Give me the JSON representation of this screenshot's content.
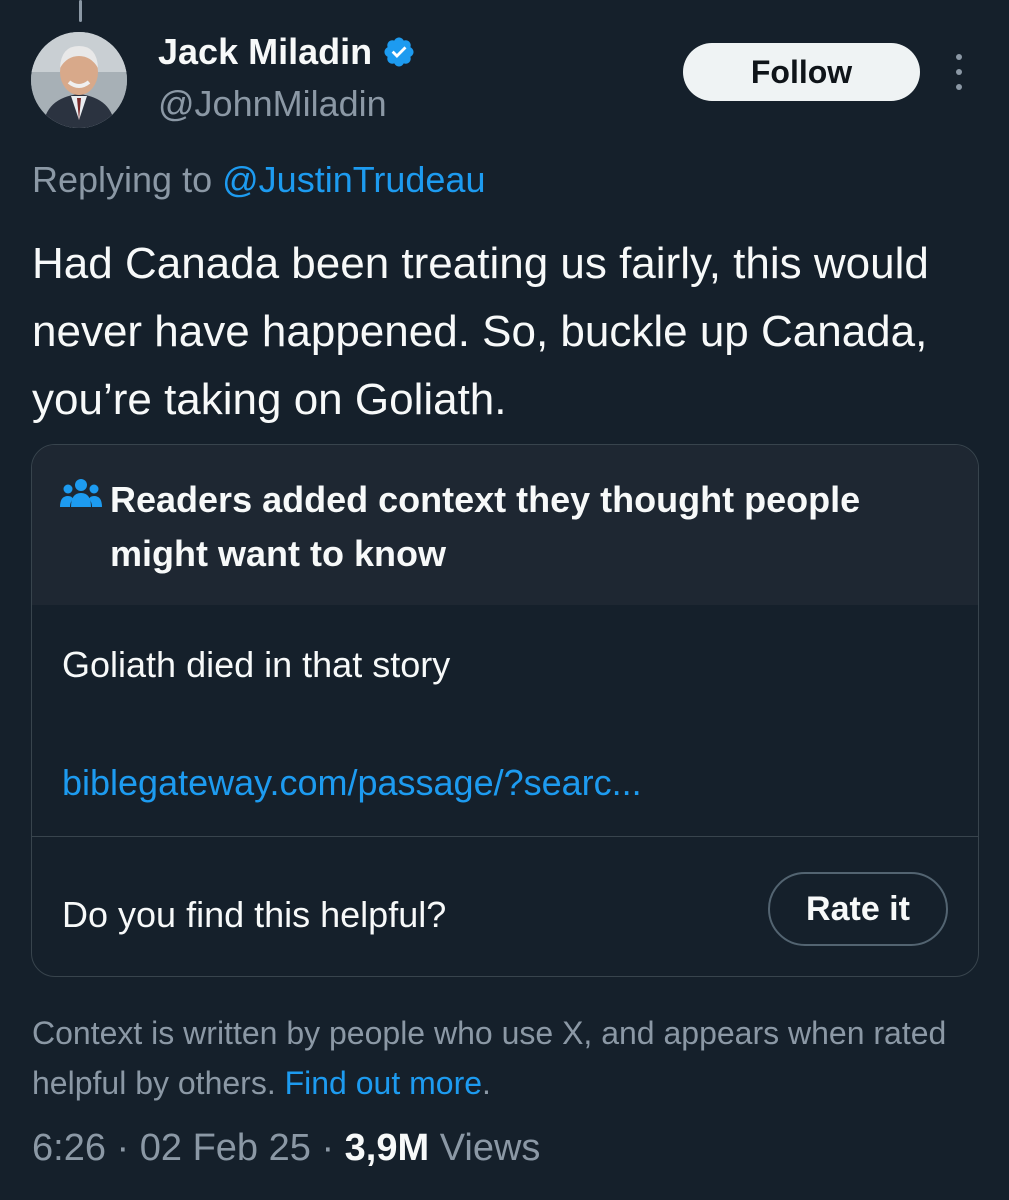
{
  "tweet": {
    "author_name": "Jack Miladin",
    "handle": "@JohnMiladin",
    "follow_label": "Follow",
    "replying_prefix": "Replying to",
    "replying_to": "@JustinTrudeau",
    "text": "Had Canada been treating us fairly, this would never have happened. So, buckle up Canada, you’re taking on Goliath."
  },
  "community_note": {
    "title": "Readers added context they thought people might want to know",
    "body": "Goliath died in that story",
    "link": "biblegateway.com/passage/?searc...",
    "helpful_question": "Do you find this helpful?",
    "rate_label": "Rate it"
  },
  "context_info": {
    "text": "Context is written by people who use X, and appears when rated helpful by others.",
    "link_text": "Find out more",
    "link_suffix": "."
  },
  "meta": {
    "time": "6:26",
    "separator": " · ",
    "date": "02 Feb 25",
    "views_count": "3,9M",
    "views_label": "Views"
  },
  "icons": {
    "verified": "verified-badge-icon",
    "people": "people-icon",
    "more": "more-options-icon"
  },
  "colors": {
    "background": "#15202b",
    "note_header": "#1e2732",
    "accent": "#1d9bf0",
    "muted": "#8b98a5"
  }
}
